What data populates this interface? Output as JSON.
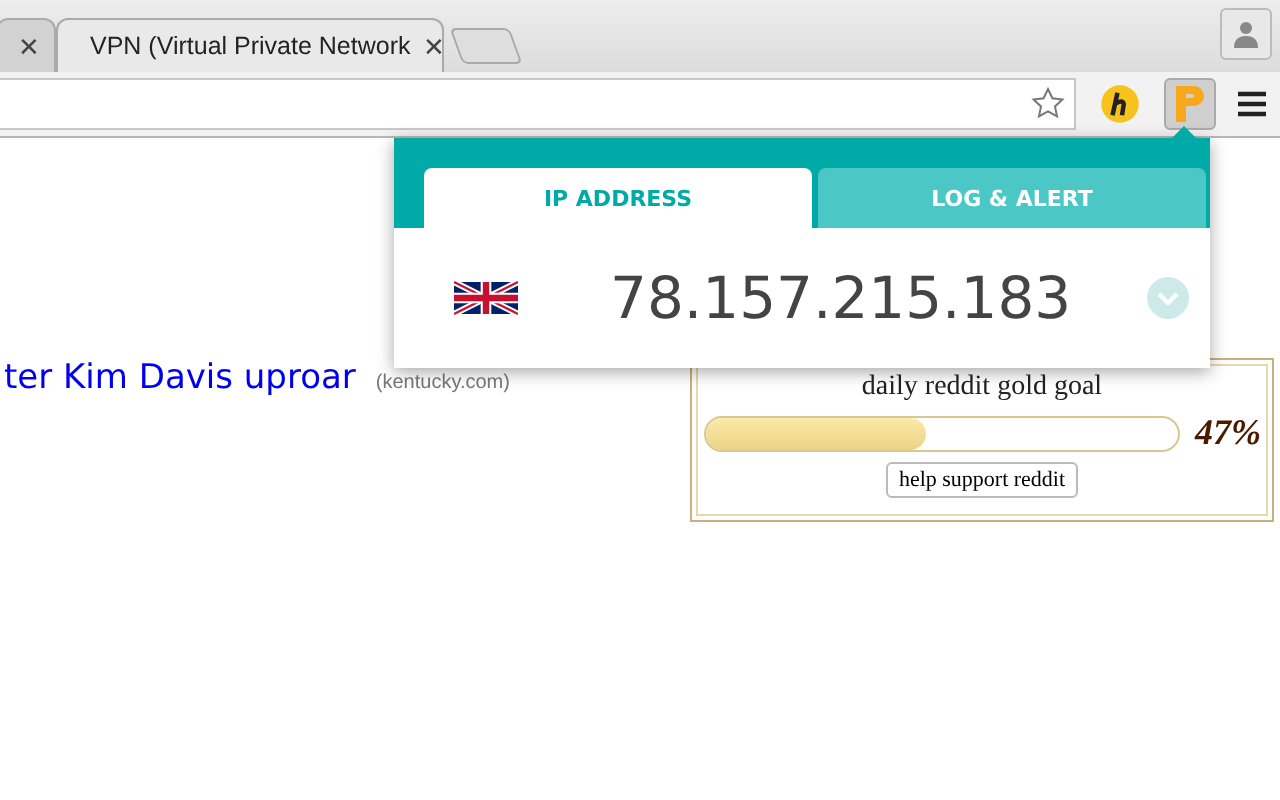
{
  "browser_tabs": [
    {
      "close": "✕",
      "selected": false
    },
    {
      "title": "VPN (Virtual Private Network",
      "close": "✕",
      "selected": true
    }
  ],
  "popup": {
    "tabs": [
      {
        "label": "IP ADDRESS",
        "selected": true
      },
      {
        "label": "LOG & ALERT",
        "selected": false
      }
    ],
    "ip": "78.157.215.183"
  },
  "page": {
    "headline": "ter Kim Davis uproar",
    "source": "(kentucky.com)",
    "gold": {
      "title": "daily reddit gold goal",
      "level": 0.47,
      "percent": "47%",
      "button": "help support reddit"
    }
  }
}
